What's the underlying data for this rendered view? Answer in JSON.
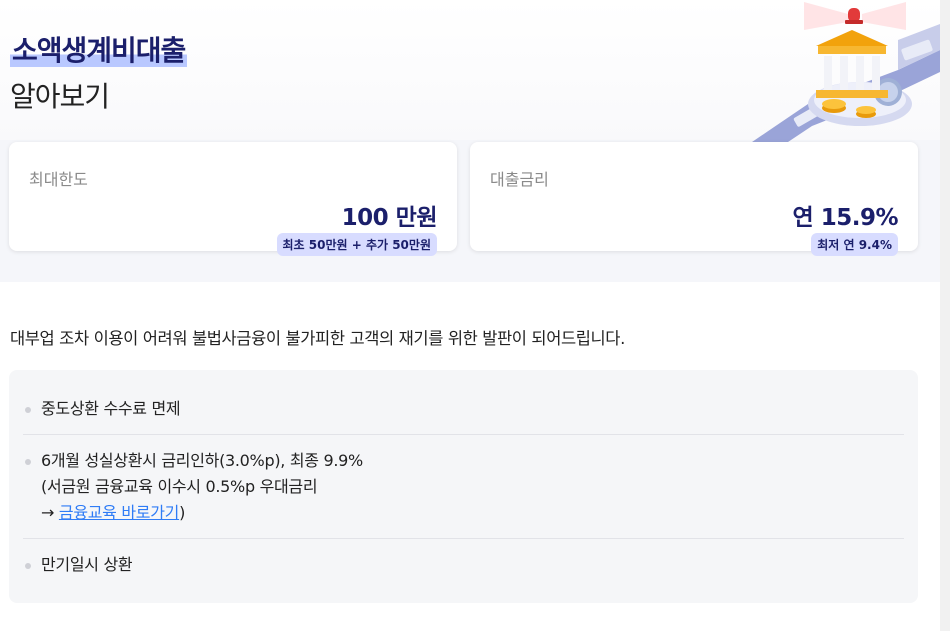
{
  "hero": {
    "title_main": "소액생계비대출",
    "title_sub": "알아보기"
  },
  "cards": [
    {
      "label": "최대한도",
      "value": "100 만원",
      "badge": "최초 50만원 + 추가 50만원"
    },
    {
      "label": "대출금리",
      "value": "연 15.9%",
      "badge": "최저 연 9.4%"
    }
  ],
  "description": "대부업 조차 이용이 어려워 불법사금융이 불가피한 고객의 재기를 위한 발판이 되어드립니다.",
  "features": {
    "item1": "중도상환 수수료 면제",
    "item2_line1": "6개월 성실상환시 금리인하(3.0%p), 최종 9.9%",
    "item2_line2": "(서금원 금융교육 이수시 0.5%p 우대금리",
    "item2_arrow": "→ ",
    "item2_link": "금융교육 바로가기",
    "item2_close": ")",
    "item3": "만기일시 상환"
  },
  "colors": {
    "navy": "#1b1f6b",
    "highlight": "#b9c8ff",
    "badge_bg": "#d8dcff",
    "link": "#2f7cf6",
    "panel_bg": "#f5f6f8"
  },
  "icons": [
    "bank-coins-illustration",
    "siren-icon"
  ]
}
